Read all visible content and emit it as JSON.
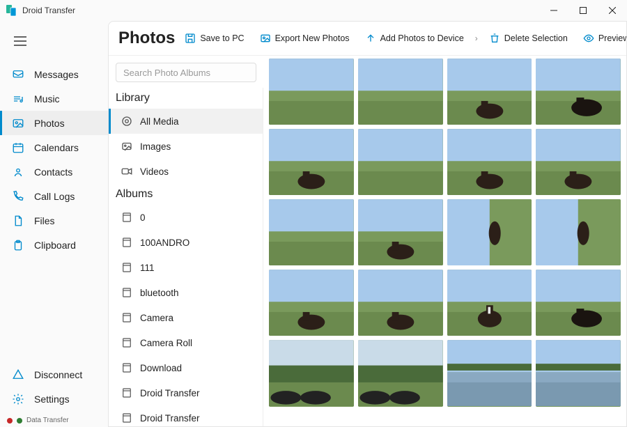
{
  "app": {
    "title": "Droid Transfer"
  },
  "nav": {
    "items": [
      {
        "icon": "message",
        "label": "Messages"
      },
      {
        "icon": "music",
        "label": "Music"
      },
      {
        "icon": "photo",
        "label": "Photos",
        "active": true
      },
      {
        "icon": "calendar",
        "label": "Calendars"
      },
      {
        "icon": "contact",
        "label": "Contacts"
      },
      {
        "icon": "phone",
        "label": "Call Logs"
      },
      {
        "icon": "file",
        "label": "Files"
      },
      {
        "icon": "clipboard",
        "label": "Clipboard"
      }
    ],
    "bottom": [
      {
        "icon": "disconnect",
        "label": "Disconnect"
      },
      {
        "icon": "settings",
        "label": "Settings"
      }
    ]
  },
  "status": {
    "label": "Data Transfer"
  },
  "page": {
    "title": "Photos",
    "tools": {
      "save": "Save to PC",
      "export": "Export New Photos",
      "add": "Add Photos to Device",
      "delete": "Delete Selection",
      "preview": "Preview"
    }
  },
  "search": {
    "placeholder": "Search Photo Albums"
  },
  "library": {
    "header": "Library",
    "items": [
      {
        "label": "All Media",
        "icon": "allmedia",
        "active": true
      },
      {
        "label": "Images",
        "icon": "images"
      },
      {
        "label": "Videos",
        "icon": "videos"
      }
    ]
  },
  "albums": {
    "header": "Albums",
    "items": [
      {
        "label": "0"
      },
      {
        "label": "100ANDRO"
      },
      {
        "label": "111"
      },
      {
        "label": "bluetooth"
      },
      {
        "label": "Camera"
      },
      {
        "label": "Camera Roll"
      },
      {
        "label": "Download"
      },
      {
        "label": "Droid Transfer"
      },
      {
        "label": "Droid Transfer"
      }
    ]
  },
  "photos": {
    "thumbs": [
      {
        "t": "field"
      },
      {
        "t": "field"
      },
      {
        "t": "horse"
      },
      {
        "t": "horse2"
      },
      {
        "t": "horse"
      },
      {
        "t": "field"
      },
      {
        "t": "horse"
      },
      {
        "t": "horse"
      },
      {
        "t": "field"
      },
      {
        "t": "horse"
      },
      {
        "t": "rotate"
      },
      {
        "t": "rotate"
      },
      {
        "t": "horse"
      },
      {
        "t": "horse"
      },
      {
        "t": "horse_face"
      },
      {
        "t": "horse2"
      },
      {
        "t": "trees"
      },
      {
        "t": "trees"
      },
      {
        "t": "lake"
      },
      {
        "t": "lake"
      }
    ]
  }
}
